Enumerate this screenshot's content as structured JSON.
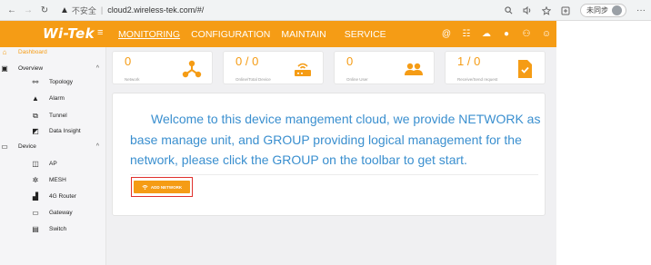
{
  "browser": {
    "insecure_label": "不安全",
    "url": "cloud2.wireless-tek.com/#/",
    "sync_label": "未同步"
  },
  "header": {
    "logo": "Wi-Tek",
    "nav": [
      "MONITORING",
      "CONFIGURATION",
      "MAINTAIN",
      "SERVICE"
    ],
    "active_tab": "MONITORING"
  },
  "sidebar": {
    "dashboard": "Dashboard",
    "overview": "Overview",
    "overview_items": [
      "Topology",
      "Alarm",
      "Tunnel",
      "Data Insight"
    ],
    "device": "Device",
    "device_items": [
      "AP",
      "MESH",
      "4G Router",
      "Gateway",
      "Switch"
    ]
  },
  "stats": [
    {
      "value": "0",
      "label": "Network",
      "icon": "network-icon"
    },
    {
      "value": "0 / 0",
      "label": "Online/Total Device",
      "icon": "router-icon"
    },
    {
      "value": "0",
      "label": "Online User",
      "icon": "users-icon"
    },
    {
      "value": "1 / 0",
      "label": "Receive/Send request",
      "icon": "document-check-icon"
    }
  ],
  "welcome": {
    "text": "Welcome to this device mangement cloud, we provide NETWORK as base manage unit, and GROUP providing logical management for the network, please click the GROUP on the toolbar to get start.",
    "add_network_label": "ADD NETWORK"
  },
  "colors": {
    "accent": "#f59c15",
    "welcome_text": "#3a8fcf",
    "highlight_border": "#e0312d"
  }
}
